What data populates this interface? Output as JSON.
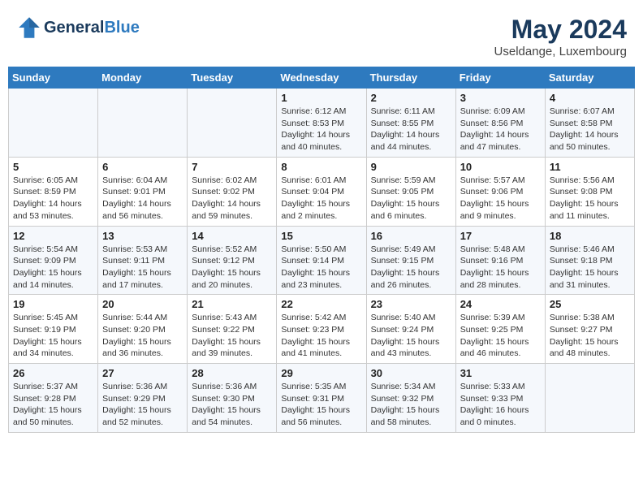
{
  "header": {
    "logo_general": "General",
    "logo_blue": "Blue",
    "month_year": "May 2024",
    "location": "Useldange, Luxembourg"
  },
  "weekdays": [
    "Sunday",
    "Monday",
    "Tuesday",
    "Wednesday",
    "Thursday",
    "Friday",
    "Saturday"
  ],
  "weeks": [
    [
      {
        "day": "",
        "info": ""
      },
      {
        "day": "",
        "info": ""
      },
      {
        "day": "",
        "info": ""
      },
      {
        "day": "1",
        "info": "Sunrise: 6:12 AM\nSunset: 8:53 PM\nDaylight: 14 hours\nand 40 minutes."
      },
      {
        "day": "2",
        "info": "Sunrise: 6:11 AM\nSunset: 8:55 PM\nDaylight: 14 hours\nand 44 minutes."
      },
      {
        "day": "3",
        "info": "Sunrise: 6:09 AM\nSunset: 8:56 PM\nDaylight: 14 hours\nand 47 minutes."
      },
      {
        "day": "4",
        "info": "Sunrise: 6:07 AM\nSunset: 8:58 PM\nDaylight: 14 hours\nand 50 minutes."
      }
    ],
    [
      {
        "day": "5",
        "info": "Sunrise: 6:05 AM\nSunset: 8:59 PM\nDaylight: 14 hours\nand 53 minutes."
      },
      {
        "day": "6",
        "info": "Sunrise: 6:04 AM\nSunset: 9:01 PM\nDaylight: 14 hours\nand 56 minutes."
      },
      {
        "day": "7",
        "info": "Sunrise: 6:02 AM\nSunset: 9:02 PM\nDaylight: 14 hours\nand 59 minutes."
      },
      {
        "day": "8",
        "info": "Sunrise: 6:01 AM\nSunset: 9:04 PM\nDaylight: 15 hours\nand 2 minutes."
      },
      {
        "day": "9",
        "info": "Sunrise: 5:59 AM\nSunset: 9:05 PM\nDaylight: 15 hours\nand 6 minutes."
      },
      {
        "day": "10",
        "info": "Sunrise: 5:57 AM\nSunset: 9:06 PM\nDaylight: 15 hours\nand 9 minutes."
      },
      {
        "day": "11",
        "info": "Sunrise: 5:56 AM\nSunset: 9:08 PM\nDaylight: 15 hours\nand 11 minutes."
      }
    ],
    [
      {
        "day": "12",
        "info": "Sunrise: 5:54 AM\nSunset: 9:09 PM\nDaylight: 15 hours\nand 14 minutes."
      },
      {
        "day": "13",
        "info": "Sunrise: 5:53 AM\nSunset: 9:11 PM\nDaylight: 15 hours\nand 17 minutes."
      },
      {
        "day": "14",
        "info": "Sunrise: 5:52 AM\nSunset: 9:12 PM\nDaylight: 15 hours\nand 20 minutes."
      },
      {
        "day": "15",
        "info": "Sunrise: 5:50 AM\nSunset: 9:14 PM\nDaylight: 15 hours\nand 23 minutes."
      },
      {
        "day": "16",
        "info": "Sunrise: 5:49 AM\nSunset: 9:15 PM\nDaylight: 15 hours\nand 26 minutes."
      },
      {
        "day": "17",
        "info": "Sunrise: 5:48 AM\nSunset: 9:16 PM\nDaylight: 15 hours\nand 28 minutes."
      },
      {
        "day": "18",
        "info": "Sunrise: 5:46 AM\nSunset: 9:18 PM\nDaylight: 15 hours\nand 31 minutes."
      }
    ],
    [
      {
        "day": "19",
        "info": "Sunrise: 5:45 AM\nSunset: 9:19 PM\nDaylight: 15 hours\nand 34 minutes."
      },
      {
        "day": "20",
        "info": "Sunrise: 5:44 AM\nSunset: 9:20 PM\nDaylight: 15 hours\nand 36 minutes."
      },
      {
        "day": "21",
        "info": "Sunrise: 5:43 AM\nSunset: 9:22 PM\nDaylight: 15 hours\nand 39 minutes."
      },
      {
        "day": "22",
        "info": "Sunrise: 5:42 AM\nSunset: 9:23 PM\nDaylight: 15 hours\nand 41 minutes."
      },
      {
        "day": "23",
        "info": "Sunrise: 5:40 AM\nSunset: 9:24 PM\nDaylight: 15 hours\nand 43 minutes."
      },
      {
        "day": "24",
        "info": "Sunrise: 5:39 AM\nSunset: 9:25 PM\nDaylight: 15 hours\nand 46 minutes."
      },
      {
        "day": "25",
        "info": "Sunrise: 5:38 AM\nSunset: 9:27 PM\nDaylight: 15 hours\nand 48 minutes."
      }
    ],
    [
      {
        "day": "26",
        "info": "Sunrise: 5:37 AM\nSunset: 9:28 PM\nDaylight: 15 hours\nand 50 minutes."
      },
      {
        "day": "27",
        "info": "Sunrise: 5:36 AM\nSunset: 9:29 PM\nDaylight: 15 hours\nand 52 minutes."
      },
      {
        "day": "28",
        "info": "Sunrise: 5:36 AM\nSunset: 9:30 PM\nDaylight: 15 hours\nand 54 minutes."
      },
      {
        "day": "29",
        "info": "Sunrise: 5:35 AM\nSunset: 9:31 PM\nDaylight: 15 hours\nand 56 minutes."
      },
      {
        "day": "30",
        "info": "Sunrise: 5:34 AM\nSunset: 9:32 PM\nDaylight: 15 hours\nand 58 minutes."
      },
      {
        "day": "31",
        "info": "Sunrise: 5:33 AM\nSunset: 9:33 PM\nDaylight: 16 hours\nand 0 minutes."
      },
      {
        "day": "",
        "info": ""
      }
    ]
  ]
}
